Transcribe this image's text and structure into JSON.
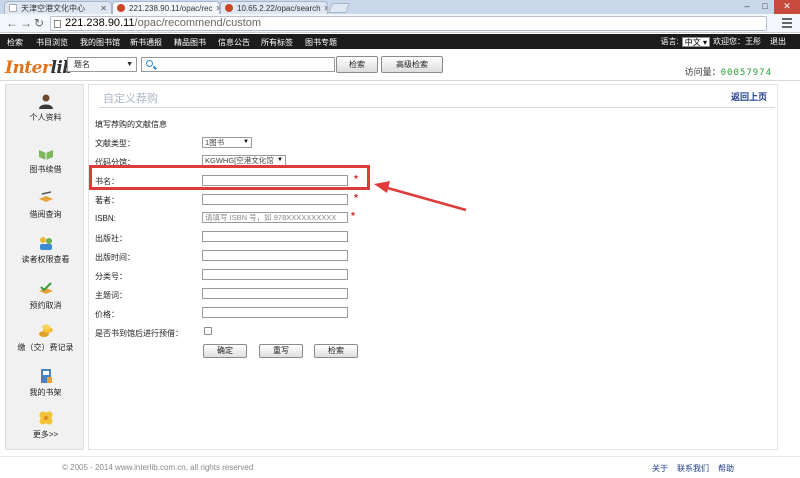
{
  "browser": {
    "tabs": [
      {
        "title": "天津空港文化中心",
        "favicon": "blank"
      },
      {
        "title": "221.238.90.11/opac/rec",
        "favicon": "red"
      },
      {
        "title": "10.65.2.22/opac/search",
        "favicon": "red"
      }
    ],
    "address": {
      "host": "221.238.90.11",
      "path": "/opac/recommend/custom"
    }
  },
  "site_nav": {
    "items": [
      "检索",
      "书目浏览",
      "我的图书馆",
      "新书通报",
      "精品图书",
      "信息公告",
      "所有标签",
      "图书专题"
    ],
    "language_label": "语言:",
    "language_value": "中文",
    "welcome": "欢迎您：王彤",
    "logout": "退出"
  },
  "header": {
    "logo": {
      "main": "Inter",
      "accent": "lib"
    },
    "search_type": "题名",
    "search_value": "",
    "search_button": "检索",
    "advanced_button": "高级检索",
    "visits_label": "访问量：",
    "visits_count": "00057974"
  },
  "sidebar": {
    "items": [
      {
        "label": "个人资料",
        "icon": "user-icon"
      },
      {
        "label": "图书续借",
        "icon": "book-renew-icon"
      },
      {
        "label": "借阅查询",
        "icon": "borrow-query-icon"
      },
      {
        "label": "读者权限查看",
        "icon": "reader-permission-icon"
      },
      {
        "label": "预约取消",
        "icon": "reservation-cancel-icon"
      },
      {
        "label": "缴（交）费记录",
        "icon": "payment-record-icon"
      },
      {
        "label": "我的书架",
        "icon": "bookshelf-icon"
      },
      {
        "label": "更多>>",
        "icon": "more-icon"
      }
    ]
  },
  "main": {
    "title": "自定义荐购",
    "back_link": "返回上页",
    "section_title": "填写荐购的文献信息",
    "fields": {
      "doc_type": {
        "label": "文献类型：",
        "value": "1图书"
      },
      "branch": {
        "label": "代码分馆：",
        "value": "KGWHG[空港文化馆"
      },
      "book_title": {
        "label": "书名：",
        "value": ""
      },
      "author": {
        "label": "著者：",
        "value": ""
      },
      "isbn": {
        "label": "ISBN:",
        "placeholder": "请填写 ISBN 号，如 978XXXXXXXXXX"
      },
      "publisher": {
        "label": "出版社：",
        "value": ""
      },
      "pub_date": {
        "label": "出版时间：",
        "value": ""
      },
      "class_no": {
        "label": "分类号：",
        "value": ""
      },
      "subject": {
        "label": "主题词：",
        "value": ""
      },
      "price": {
        "label": "价格：",
        "value": ""
      },
      "reserve": {
        "label": "是否书到馆后进行预借：",
        "checked": false
      }
    },
    "required_mark": "*",
    "buttons": {
      "confirm": "确定",
      "reset": "重写",
      "search": "检索"
    }
  },
  "footer": {
    "copyright": "© 2005 - 2014 www.interlib.com.cn, all rights reserved",
    "links": [
      "关于",
      "联系我们",
      "帮助"
    ]
  },
  "colors": {
    "nav_bg": "#1c1c1c",
    "highlight": "#e03b3b",
    "required": "#d21f1f",
    "visits": "#2a9a36",
    "logo_orange": "#e0731c",
    "link": "#1e3c8c"
  }
}
